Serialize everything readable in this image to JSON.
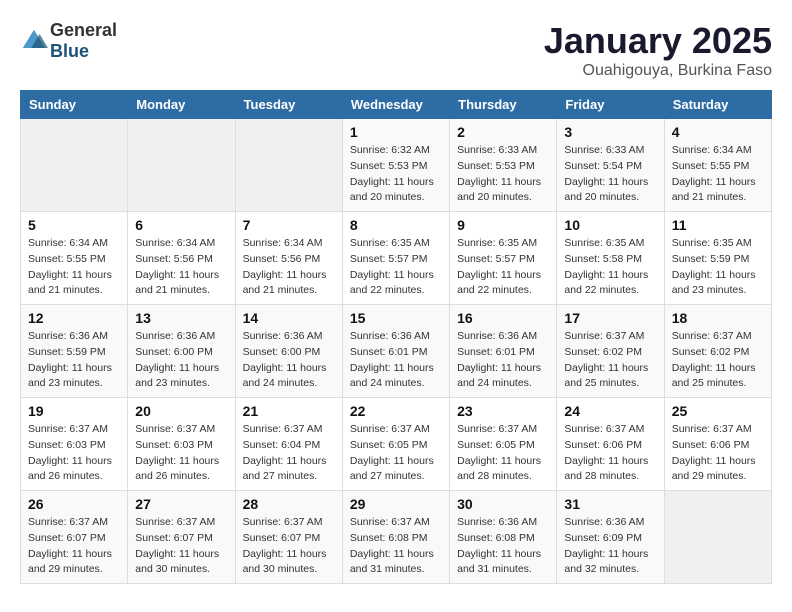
{
  "header": {
    "logo_general": "General",
    "logo_blue": "Blue",
    "month": "January 2025",
    "location": "Ouahigouya, Burkina Faso"
  },
  "weekdays": [
    "Sunday",
    "Monday",
    "Tuesday",
    "Wednesday",
    "Thursday",
    "Friday",
    "Saturday"
  ],
  "weeks": [
    [
      {
        "day": "",
        "sunrise": "",
        "sunset": "",
        "daylight": ""
      },
      {
        "day": "",
        "sunrise": "",
        "sunset": "",
        "daylight": ""
      },
      {
        "day": "",
        "sunrise": "",
        "sunset": "",
        "daylight": ""
      },
      {
        "day": "1",
        "sunrise": "Sunrise: 6:32 AM",
        "sunset": "Sunset: 5:53 PM",
        "daylight": "Daylight: 11 hours and 20 minutes."
      },
      {
        "day": "2",
        "sunrise": "Sunrise: 6:33 AM",
        "sunset": "Sunset: 5:53 PM",
        "daylight": "Daylight: 11 hours and 20 minutes."
      },
      {
        "day": "3",
        "sunrise": "Sunrise: 6:33 AM",
        "sunset": "Sunset: 5:54 PM",
        "daylight": "Daylight: 11 hours and 20 minutes."
      },
      {
        "day": "4",
        "sunrise": "Sunrise: 6:34 AM",
        "sunset": "Sunset: 5:55 PM",
        "daylight": "Daylight: 11 hours and 21 minutes."
      }
    ],
    [
      {
        "day": "5",
        "sunrise": "Sunrise: 6:34 AM",
        "sunset": "Sunset: 5:55 PM",
        "daylight": "Daylight: 11 hours and 21 minutes."
      },
      {
        "day": "6",
        "sunrise": "Sunrise: 6:34 AM",
        "sunset": "Sunset: 5:56 PM",
        "daylight": "Daylight: 11 hours and 21 minutes."
      },
      {
        "day": "7",
        "sunrise": "Sunrise: 6:34 AM",
        "sunset": "Sunset: 5:56 PM",
        "daylight": "Daylight: 11 hours and 21 minutes."
      },
      {
        "day": "8",
        "sunrise": "Sunrise: 6:35 AM",
        "sunset": "Sunset: 5:57 PM",
        "daylight": "Daylight: 11 hours and 22 minutes."
      },
      {
        "day": "9",
        "sunrise": "Sunrise: 6:35 AM",
        "sunset": "Sunset: 5:57 PM",
        "daylight": "Daylight: 11 hours and 22 minutes."
      },
      {
        "day": "10",
        "sunrise": "Sunrise: 6:35 AM",
        "sunset": "Sunset: 5:58 PM",
        "daylight": "Daylight: 11 hours and 22 minutes."
      },
      {
        "day": "11",
        "sunrise": "Sunrise: 6:35 AM",
        "sunset": "Sunset: 5:59 PM",
        "daylight": "Daylight: 11 hours and 23 minutes."
      }
    ],
    [
      {
        "day": "12",
        "sunrise": "Sunrise: 6:36 AM",
        "sunset": "Sunset: 5:59 PM",
        "daylight": "Daylight: 11 hours and 23 minutes."
      },
      {
        "day": "13",
        "sunrise": "Sunrise: 6:36 AM",
        "sunset": "Sunset: 6:00 PM",
        "daylight": "Daylight: 11 hours and 23 minutes."
      },
      {
        "day": "14",
        "sunrise": "Sunrise: 6:36 AM",
        "sunset": "Sunset: 6:00 PM",
        "daylight": "Daylight: 11 hours and 24 minutes."
      },
      {
        "day": "15",
        "sunrise": "Sunrise: 6:36 AM",
        "sunset": "Sunset: 6:01 PM",
        "daylight": "Daylight: 11 hours and 24 minutes."
      },
      {
        "day": "16",
        "sunrise": "Sunrise: 6:36 AM",
        "sunset": "Sunset: 6:01 PM",
        "daylight": "Daylight: 11 hours and 24 minutes."
      },
      {
        "day": "17",
        "sunrise": "Sunrise: 6:37 AM",
        "sunset": "Sunset: 6:02 PM",
        "daylight": "Daylight: 11 hours and 25 minutes."
      },
      {
        "day": "18",
        "sunrise": "Sunrise: 6:37 AM",
        "sunset": "Sunset: 6:02 PM",
        "daylight": "Daylight: 11 hours and 25 minutes."
      }
    ],
    [
      {
        "day": "19",
        "sunrise": "Sunrise: 6:37 AM",
        "sunset": "Sunset: 6:03 PM",
        "daylight": "Daylight: 11 hours and 26 minutes."
      },
      {
        "day": "20",
        "sunrise": "Sunrise: 6:37 AM",
        "sunset": "Sunset: 6:03 PM",
        "daylight": "Daylight: 11 hours and 26 minutes."
      },
      {
        "day": "21",
        "sunrise": "Sunrise: 6:37 AM",
        "sunset": "Sunset: 6:04 PM",
        "daylight": "Daylight: 11 hours and 27 minutes."
      },
      {
        "day": "22",
        "sunrise": "Sunrise: 6:37 AM",
        "sunset": "Sunset: 6:05 PM",
        "daylight": "Daylight: 11 hours and 27 minutes."
      },
      {
        "day": "23",
        "sunrise": "Sunrise: 6:37 AM",
        "sunset": "Sunset: 6:05 PM",
        "daylight": "Daylight: 11 hours and 28 minutes."
      },
      {
        "day": "24",
        "sunrise": "Sunrise: 6:37 AM",
        "sunset": "Sunset: 6:06 PM",
        "daylight": "Daylight: 11 hours and 28 minutes."
      },
      {
        "day": "25",
        "sunrise": "Sunrise: 6:37 AM",
        "sunset": "Sunset: 6:06 PM",
        "daylight": "Daylight: 11 hours and 29 minutes."
      }
    ],
    [
      {
        "day": "26",
        "sunrise": "Sunrise: 6:37 AM",
        "sunset": "Sunset: 6:07 PM",
        "daylight": "Daylight: 11 hours and 29 minutes."
      },
      {
        "day": "27",
        "sunrise": "Sunrise: 6:37 AM",
        "sunset": "Sunset: 6:07 PM",
        "daylight": "Daylight: 11 hours and 30 minutes."
      },
      {
        "day": "28",
        "sunrise": "Sunrise: 6:37 AM",
        "sunset": "Sunset: 6:07 PM",
        "daylight": "Daylight: 11 hours and 30 minutes."
      },
      {
        "day": "29",
        "sunrise": "Sunrise: 6:37 AM",
        "sunset": "Sunset: 6:08 PM",
        "daylight": "Daylight: 11 hours and 31 minutes."
      },
      {
        "day": "30",
        "sunrise": "Sunrise: 6:36 AM",
        "sunset": "Sunset: 6:08 PM",
        "daylight": "Daylight: 11 hours and 31 minutes."
      },
      {
        "day": "31",
        "sunrise": "Sunrise: 6:36 AM",
        "sunset": "Sunset: 6:09 PM",
        "daylight": "Daylight: 11 hours and 32 minutes."
      },
      {
        "day": "",
        "sunrise": "",
        "sunset": "",
        "daylight": ""
      }
    ]
  ]
}
